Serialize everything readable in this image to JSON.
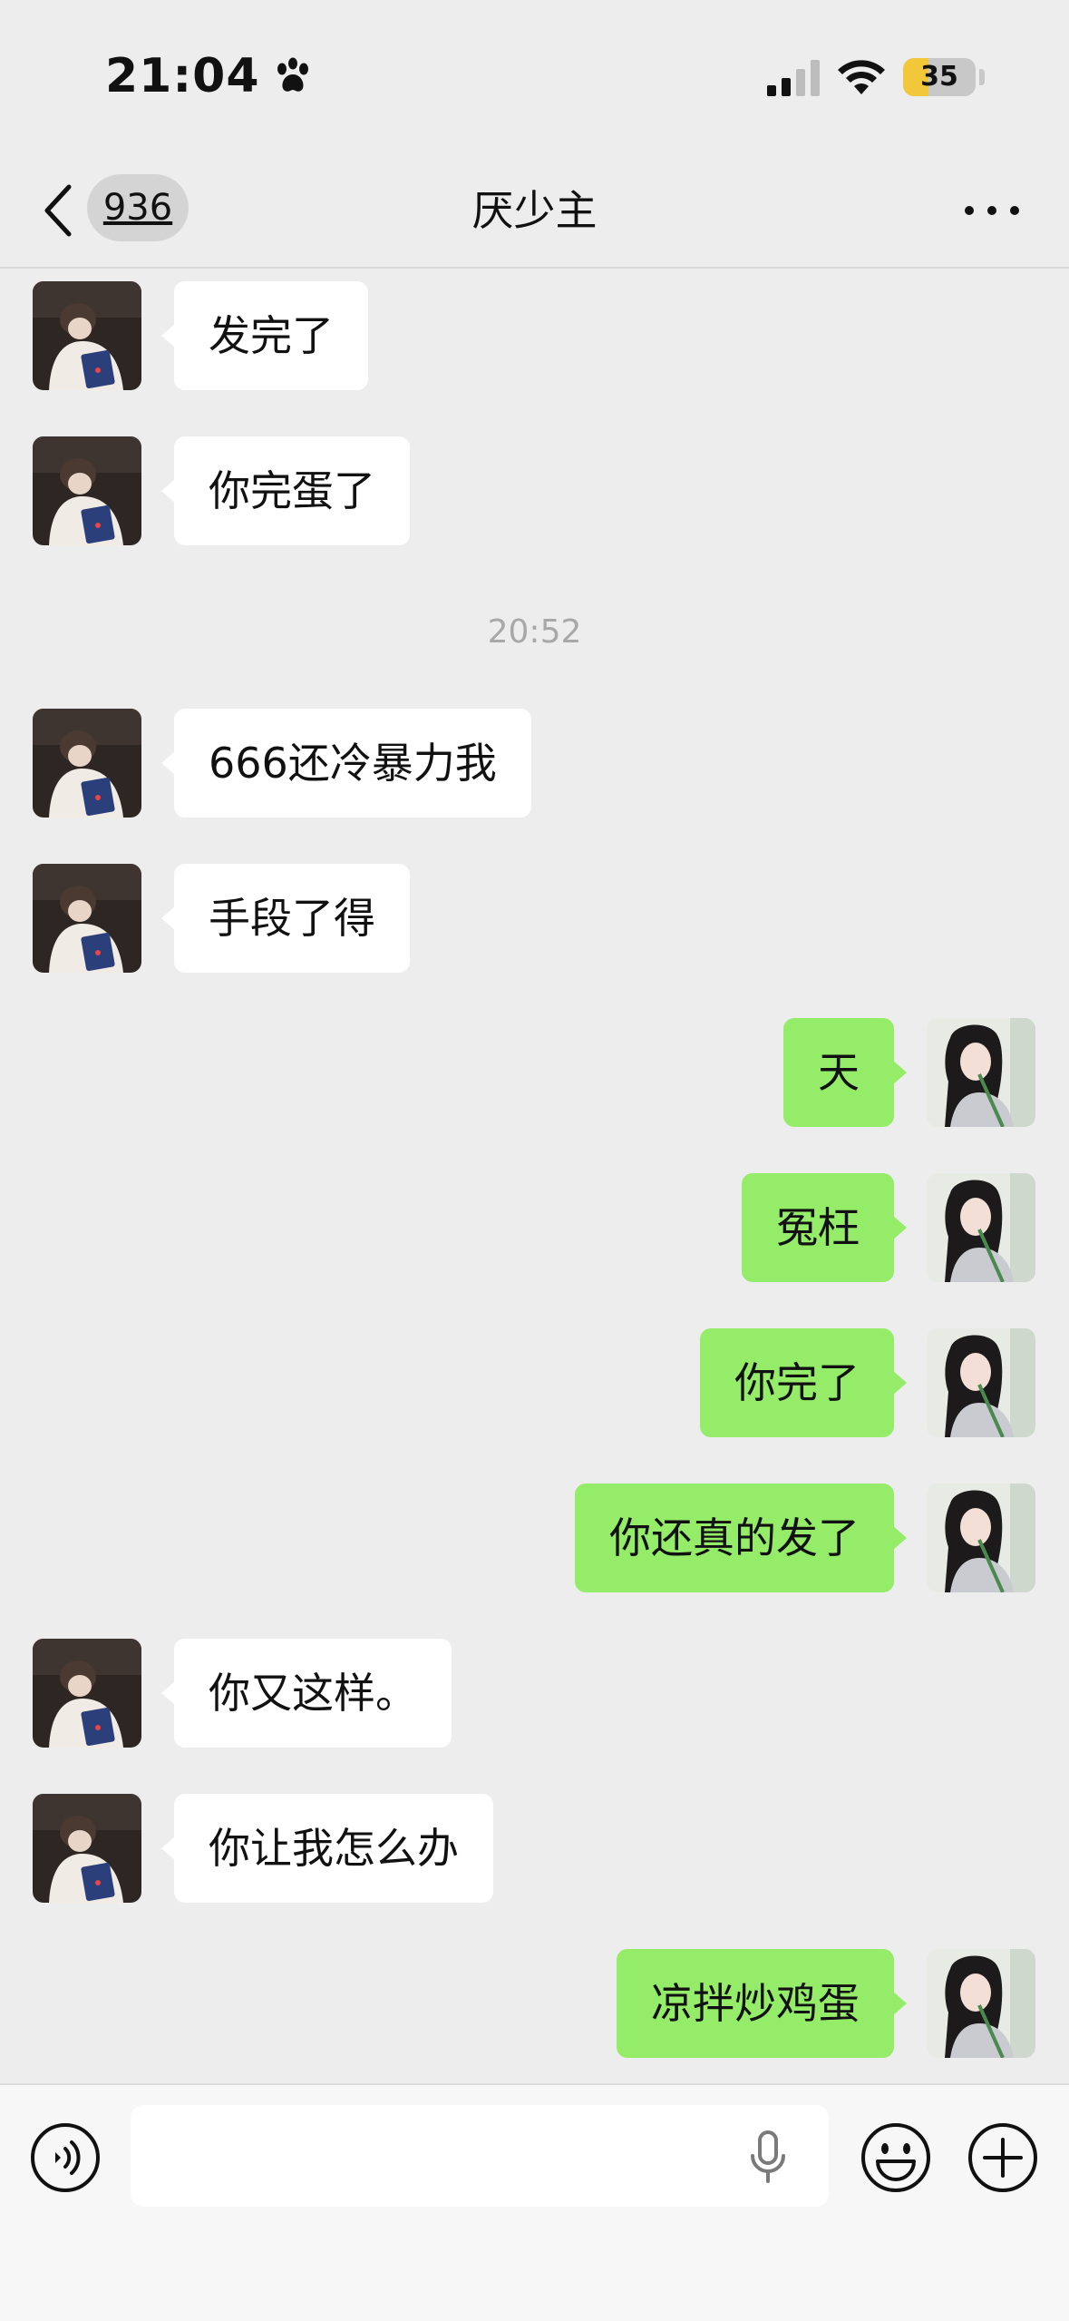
{
  "status_bar": {
    "time": "21:04",
    "battery_level": "35",
    "battery_fraction": 0.35
  },
  "header": {
    "unread_count": "936",
    "title": "厌少主"
  },
  "messages": [
    {
      "type": "text",
      "from": "contact",
      "text": "发完了"
    },
    {
      "type": "text",
      "from": "contact",
      "text": "你完蛋了"
    },
    {
      "type": "time",
      "text": "20:52"
    },
    {
      "type": "text",
      "from": "contact",
      "text": "666还冷暴力我"
    },
    {
      "type": "text",
      "from": "contact",
      "text": "手段了得"
    },
    {
      "type": "text",
      "from": "me",
      "text": "天"
    },
    {
      "type": "text",
      "from": "me",
      "text": "冤枉"
    },
    {
      "type": "text",
      "from": "me",
      "text": "你完了"
    },
    {
      "type": "text",
      "from": "me",
      "text": "你还真的发了"
    },
    {
      "type": "text",
      "from": "contact",
      "text": "你又这样。"
    },
    {
      "type": "text",
      "from": "contact",
      "text": "你让我怎么办"
    },
    {
      "type": "text",
      "from": "me",
      "text": "凉拌炒鸡蛋"
    }
  ],
  "input_bar": {
    "input_value": "",
    "placeholder": ""
  },
  "icons": {
    "back": "chevron-left-icon",
    "more": "more-dots-icon",
    "voice": "voice-mode-icon",
    "mic": "microphone-icon",
    "emoji": "emoji-icon",
    "plus": "plus-circle-icon"
  },
  "colors": {
    "background": "#ededed",
    "incoming_bubble": "#ffffff",
    "outgoing_bubble": "#95ec69",
    "battery_fill": "#f2c83a",
    "timestamp_text": "#a8a8a8"
  }
}
